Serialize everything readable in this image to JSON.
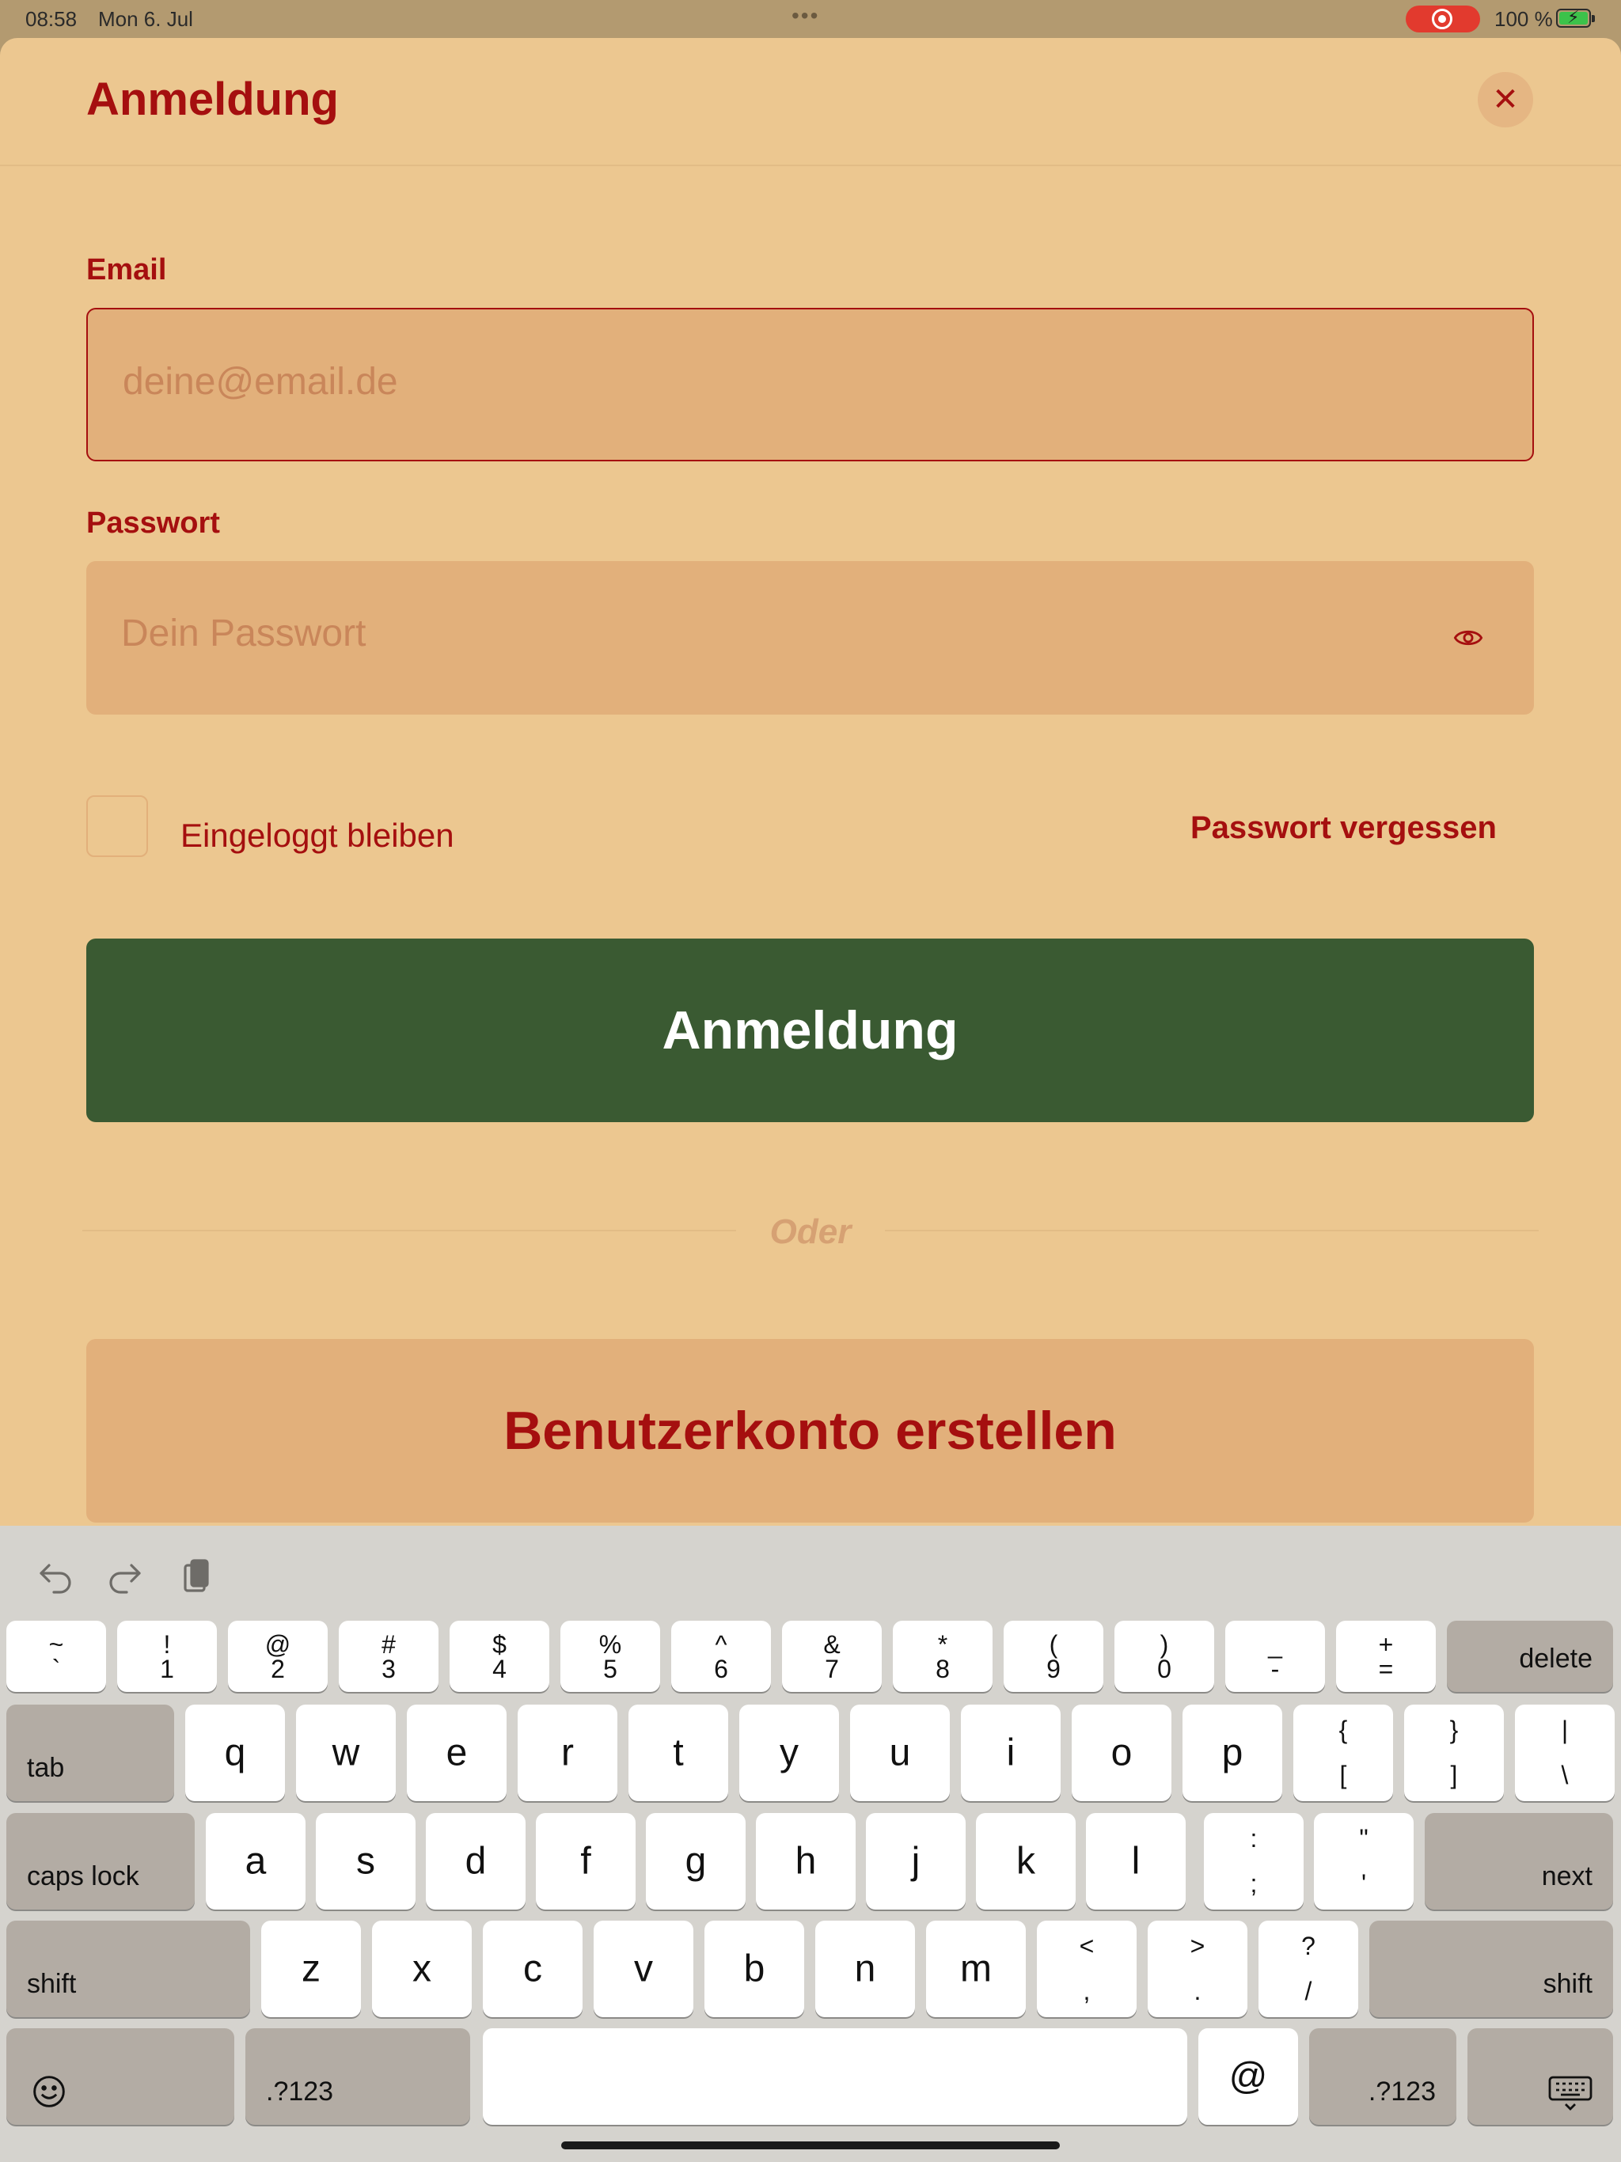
{
  "status_bar": {
    "time": "08:58",
    "date": "Mon 6. Jul",
    "battery": "100 %"
  },
  "header": {
    "title": "Anmeldung"
  },
  "form": {
    "email_label": "Email",
    "email_placeholder": "deine@email.de",
    "password_label": "Passwort",
    "password_placeholder": "Dein Passwort",
    "remember_label": "Eingeloggt bleiben",
    "forgot_label": "Passwort vergessen",
    "login_label": "Anmeldung",
    "or_label": "Oder",
    "create_label": "Benutzerkonto erstellen"
  },
  "keyboard": {
    "row1": [
      {
        "top": "~",
        "bot": "`"
      },
      {
        "top": "!",
        "bot": "1"
      },
      {
        "top": "@",
        "bot": "2"
      },
      {
        "top": "#",
        "bot": "3"
      },
      {
        "top": "$",
        "bot": "4"
      },
      {
        "top": "%",
        "bot": "5"
      },
      {
        "top": "^",
        "bot": "6"
      },
      {
        "top": "&",
        "bot": "7"
      },
      {
        "top": "*",
        "bot": "8"
      },
      {
        "top": "(",
        "bot": "9"
      },
      {
        "top": ")",
        "bot": "0"
      },
      {
        "top": "_",
        "bot": "-"
      },
      {
        "top": "+",
        "bot": "="
      }
    ],
    "delete": "delete",
    "tab": "tab",
    "row2": [
      "q",
      "w",
      "e",
      "r",
      "t",
      "y",
      "u",
      "i",
      "o",
      "p"
    ],
    "row2_sym": [
      {
        "top": "{",
        "bot": "["
      },
      {
        "top": "}",
        "bot": "]"
      },
      {
        "top": "|",
        "bot": "\\"
      }
    ],
    "caps": "caps lock",
    "row3": [
      "a",
      "s",
      "d",
      "f",
      "g",
      "h",
      "j",
      "k",
      "l"
    ],
    "row3_sym": [
      {
        "top": ":",
        "bot": ";"
      },
      {
        "top": "\"",
        "bot": "'"
      }
    ],
    "next": "next",
    "shift": "shift",
    "row4": [
      "z",
      "x",
      "c",
      "v",
      "b",
      "n",
      "m"
    ],
    "row4_sym": [
      {
        "top": "<",
        "bot": ","
      },
      {
        "top": ">",
        "bot": "."
      },
      {
        "top": "?",
        "bot": "/"
      }
    ],
    "numbers": ".?123",
    "at": "@"
  },
  "colors": {
    "accent": "#a50f0f",
    "primary_button": "#3a5a32",
    "background": "#ecc790",
    "field": "#e2b07b"
  }
}
